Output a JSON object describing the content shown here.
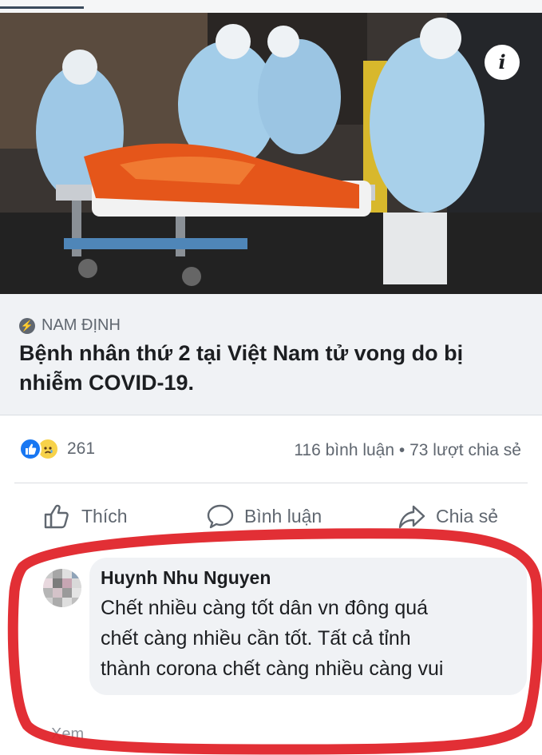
{
  "post": {
    "info_icon": "i",
    "source_icon": "lightning-bolt-icon",
    "source": "NAM ĐỊNH",
    "headline": "Bệnh nhân thứ 2 tại Việt Nam tử vong do bị nhiễm COVID-19.",
    "reaction_icons": [
      "like-reaction-icon",
      "sad-reaction-icon"
    ],
    "reaction_count": "261",
    "comment_count": "116 bình luận",
    "share_count": "73 lượt chia sẻ",
    "separator": "•"
  },
  "actions": {
    "like": "Thích",
    "comment": "Bình luận",
    "share": "Chia sẻ"
  },
  "comment": {
    "author": "Huynh Nhu Nguyen",
    "lines": [
      "Chết nhiều càng tốt dân vn đông quá",
      "chết càng nhiều cần tốt. Tất cả tỉnh",
      "thành  corona chết càng nhiều càng vui"
    ],
    "reply_partial": "Xem"
  },
  "colors": {
    "accent_blue": "#1877f2",
    "meta_grey": "#606770",
    "highlight_red": "#e0242a"
  }
}
